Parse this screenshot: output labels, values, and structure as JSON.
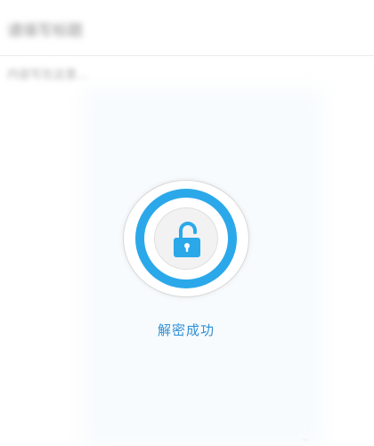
{
  "editor": {
    "title_text": "请填写标题",
    "content_text": "内容写在这里..."
  },
  "unlock": {
    "status_label": "解密成功",
    "icon": "unlocked-padlock-icon",
    "colors": {
      "accent": "#2ba8ea",
      "text": "#2f8fd6",
      "inner": "#f2f2f2"
    }
  }
}
